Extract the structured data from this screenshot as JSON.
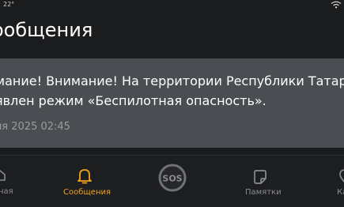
{
  "status_bar": {
    "time": "22°",
    "icons": [
      "wifi-icon"
    ]
  },
  "header": {
    "title": "ообщения"
  },
  "message": {
    "line1": "мание! Внимание! На территории Республики Татарс",
    "line2": "явлен режим «Беспилотная опасность».",
    "date": "ля 2025 02:45"
  },
  "bottom_nav": {
    "items": [
      {
        "label": "ная",
        "icon": "home-icon",
        "active": false
      },
      {
        "label": "Сообщения",
        "icon": "bell-icon",
        "active": true
      },
      {
        "label": "",
        "icon": "sos-icon",
        "active": false,
        "text": "SOS"
      },
      {
        "label": "Памятки",
        "icon": "note-icon",
        "active": false
      },
      {
        "label": "Ка",
        "icon": "map-icon",
        "active": false
      }
    ]
  },
  "colors": {
    "background": "#1b1c1e",
    "card": "#4a4d52",
    "accent": "#f0a51e",
    "muted": "#8a8c90"
  }
}
